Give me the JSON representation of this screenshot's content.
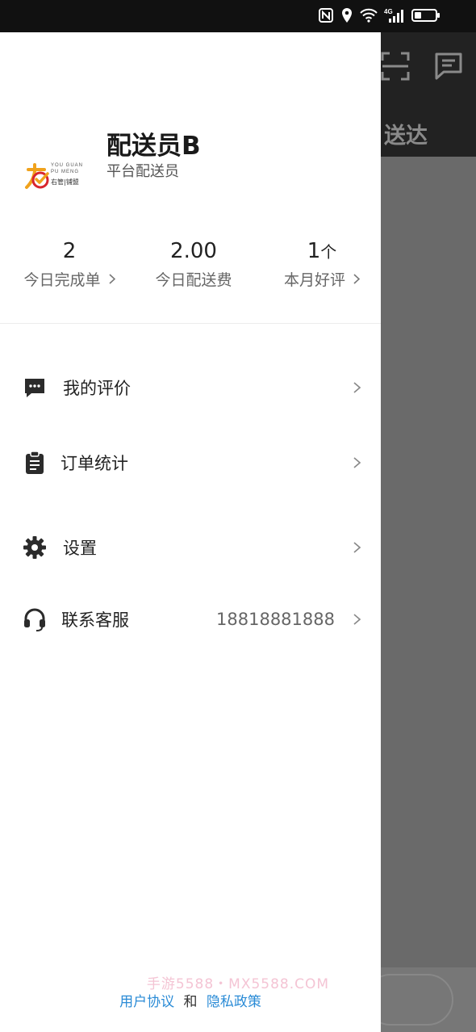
{
  "status_bar": {
    "icons": [
      "nfc-icon",
      "location-icon",
      "wifi-icon",
      "signal-4g-icon",
      "battery-icon"
    ],
    "network": "4G"
  },
  "background": {
    "title_fragment": "送达"
  },
  "profile": {
    "name": "配送员B",
    "role": "平台配送员",
    "logo_text_top": "YOU GUAN",
    "logo_text_mid": "PU MENG",
    "logo_text_bottom": "右管|铺盟"
  },
  "stats": [
    {
      "value": "2",
      "unit": "",
      "label": "今日完成单",
      "has_chevron": true
    },
    {
      "value": "2.00",
      "unit": "",
      "label": "今日配送费",
      "has_chevron": false
    },
    {
      "value": "1",
      "unit": "个",
      "label": "本月好评",
      "has_chevron": true
    }
  ],
  "menu": [
    {
      "label": "我的评价",
      "icon": "comment-icon",
      "value": ""
    },
    {
      "label": "订单统计",
      "icon": "clipboard-icon",
      "value": ""
    },
    {
      "label": "设置",
      "icon": "gear-icon",
      "value": ""
    },
    {
      "label": "联系客服",
      "icon": "headset-icon",
      "value": "18818881888"
    }
  ],
  "footer": {
    "user_agreement": "用户协议",
    "conjunction": "和",
    "privacy_policy": "隐私政策"
  },
  "watermark": "手游5588・MX5588.COM",
  "colors": {
    "link": "#2a8bd6",
    "logo_orange": "#f0a21c",
    "logo_red": "#d8262e",
    "status_bar": "#111111"
  }
}
